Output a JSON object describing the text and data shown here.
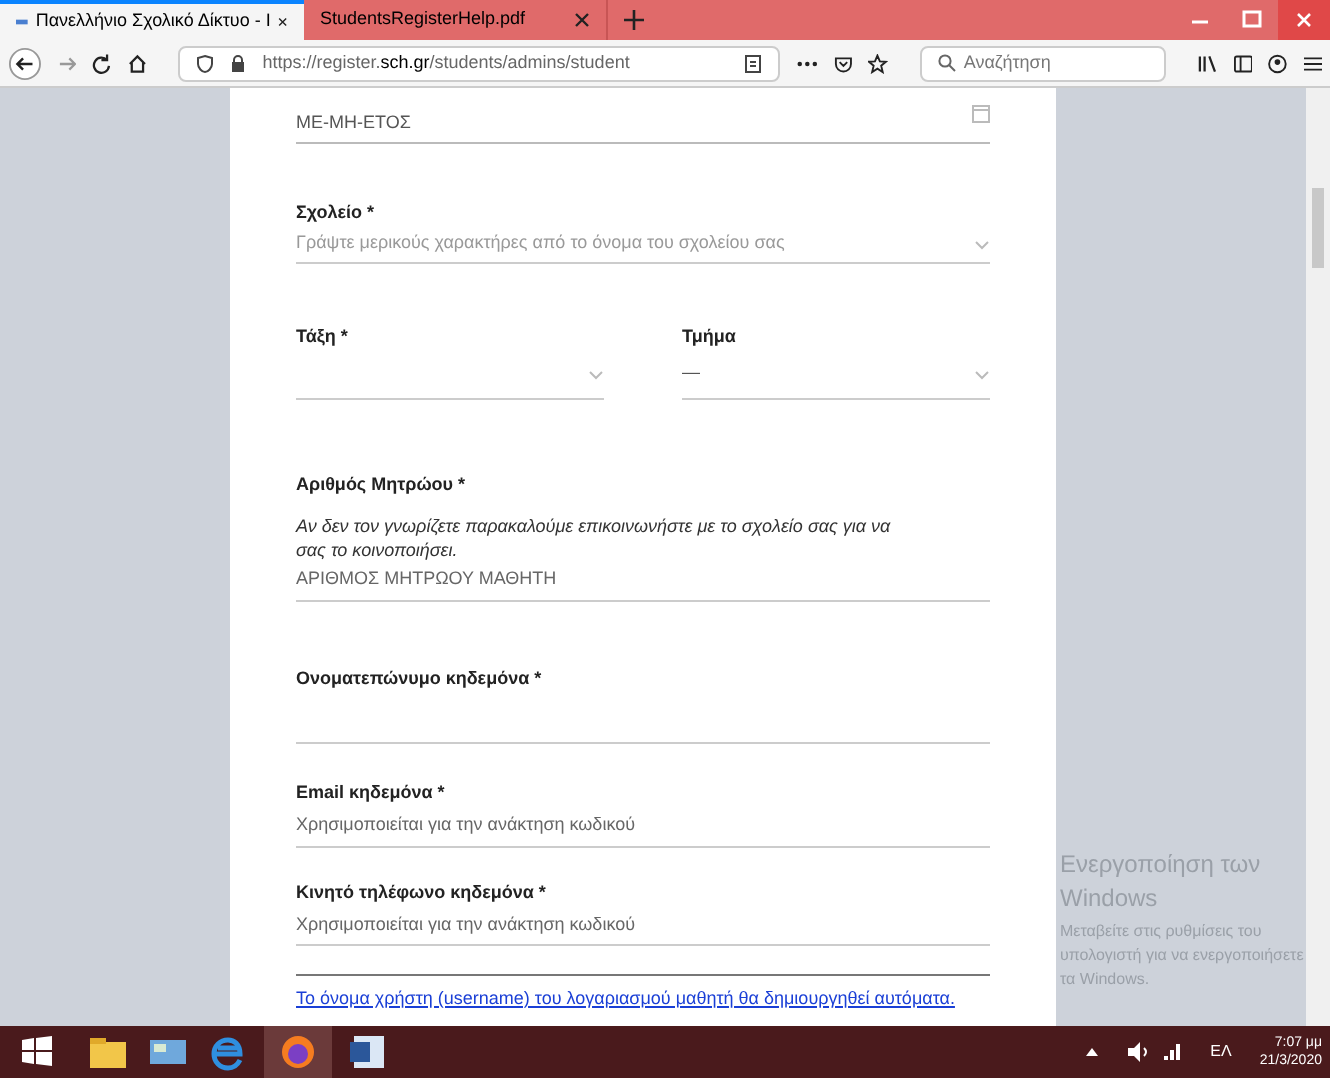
{
  "browser": {
    "tabs": [
      {
        "title": "Πανελλήνιο Σχολικό Δίκτυο - Ι",
        "selected": true
      },
      {
        "title": "StudentsRegisterHelp.pdf",
        "selected": false
      }
    ],
    "url": {
      "prefix": "https://register.",
      "domain": "sch.gr",
      "path": "/students/admins/student"
    },
    "search": {
      "placeholder": "Αναζήτηση"
    }
  },
  "form": {
    "date_field": {
      "value": "ΜΕ-ΜΗ-ΕΤΟΣ"
    },
    "fields": [
      {
        "kind": "select",
        "label": "Σχολείο *",
        "placeholder": "Γράψτε μερικούς χαρακτήρες από το όνομα του σχολείου σας"
      },
      {
        "kind": "pair",
        "items": [
          {
            "label": "Τάξη *",
            "value": ""
          },
          {
            "label": "Τμήμα",
            "value": "—"
          }
        ]
      },
      {
        "kind": "text",
        "label": "Αριθμός Μητρώου *",
        "hint": "Αν δεν τον γνωρίζετε παρακαλούμε επικοινωνήστε με το σχολείο σας για να σας το κοινοποιήσει.",
        "placeholder": "ΑΡΙΘΜΟΣ ΜΗΤΡΩΟΥ ΜΑΘΗΤΗ"
      },
      {
        "kind": "text",
        "label": "Ονοματεπώνυμο κηδεμόνα *"
      },
      {
        "kind": "text",
        "label": "Email κηδεμόνα *",
        "placeholder": "Χρησιμοποιείται για την ανάκτηση κωδικού"
      },
      {
        "kind": "text",
        "label": "Κινητό τηλέφωνο κηδεμόνα *",
        "placeholder": "Χρησιμοποιείται για την ανάκτηση κωδικού"
      },
      {
        "kind": "rule"
      }
    ],
    "note": "Το όνομα χρήστη (username) του λογαριασμού μαθητή θα δημιουργηθεί αυτόματα."
  },
  "activation": {
    "title": "Ενεργοποίηση των Windows",
    "text": "Μεταβείτε στις ρυθμίσεις του υπολογιστή για να ενεργοποιήσετε τα Windows."
  },
  "taskbar": {
    "language": "ΕΛ",
    "time": "7:07 μμ",
    "date": "21/3/2020"
  }
}
